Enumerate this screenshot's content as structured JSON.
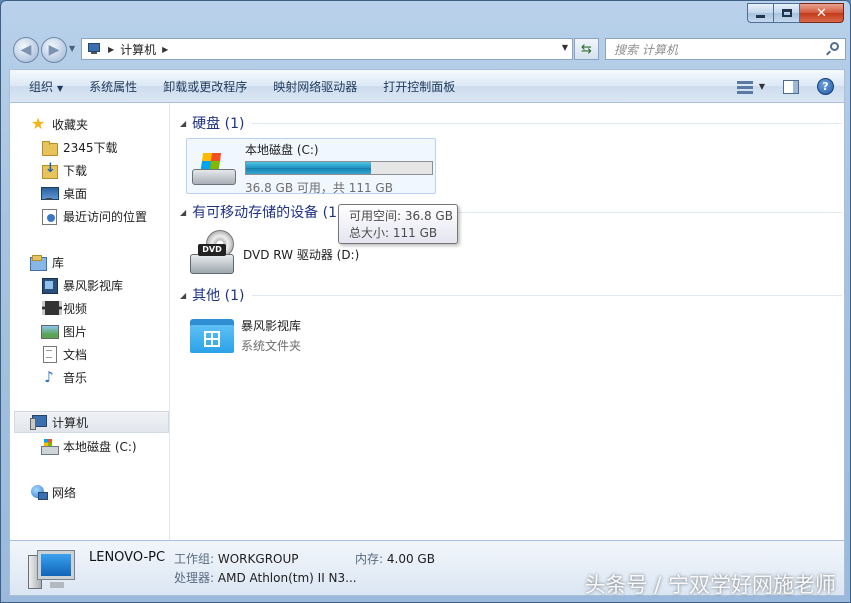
{
  "address": {
    "path": "计算机"
  },
  "search": {
    "placeholder": "搜索 计算机"
  },
  "toolbar": {
    "items": [
      "组织",
      "系统属性",
      "卸载或更改程序",
      "映射网络驱动器",
      "打开控制面板"
    ],
    "help": "?"
  },
  "sidebar": {
    "favorites": {
      "label": "收藏夹",
      "items": [
        "2345下载",
        "下载",
        "桌面",
        "最近访问的位置"
      ]
    },
    "libraries": {
      "label": "库",
      "items": [
        "暴风影视库",
        "视频",
        "图片",
        "文档",
        "音乐"
      ]
    },
    "computer": {
      "label": "计算机",
      "items": [
        "本地磁盘 (C:)"
      ]
    },
    "network": {
      "label": "网络"
    }
  },
  "groups": {
    "hdd": {
      "title": "硬盘 (1)"
    },
    "removable": {
      "title": "有可移动存储的设备 (1)"
    },
    "other": {
      "title": "其他 (1)"
    }
  },
  "drives": {
    "c": {
      "name": "本地磁盘 (C:)",
      "space": "36.8 GB 可用，共 111 GB",
      "used_fraction": 0.67
    },
    "dvd": {
      "name": "DVD RW 驱动器 (D:)",
      "label": "DVD"
    },
    "lib": {
      "name": "暴风影视库",
      "type": "系统文件夹"
    }
  },
  "tooltip": {
    "free": "可用空间: 36.8 GB",
    "total": "总大小: 111 GB"
  },
  "details": {
    "pc_name": "LENOVO-PC",
    "workgroup_label": "工作组:",
    "workgroup": "WORKGROUP",
    "memory_label": "内存:",
    "memory": "4.00 GB",
    "cpu_label": "处理器:",
    "cpu": "AMD Athlon(tm) II N3..."
  },
  "watermark": "头条号 / 宁双学好网施老师"
}
